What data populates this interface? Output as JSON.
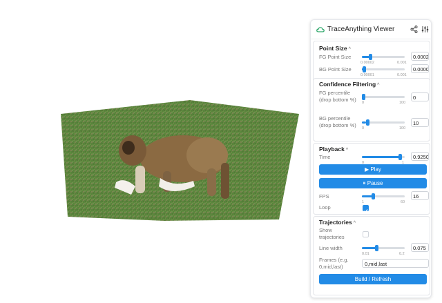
{
  "app": {
    "title": "TraceAnything Viewer"
  },
  "icons": {
    "logo": "cloud-icon",
    "share": "share-icon",
    "settings": "sliders-icon"
  },
  "colors": {
    "accent": "#228be6",
    "panel_border": "#e6e8ec"
  },
  "point_size": {
    "title": "Point Size",
    "fg": {
      "label": "FG Point Size",
      "min": "0.00002",
      "max": "0.001",
      "value": "0.0002",
      "fraction": 0.18
    },
    "bg": {
      "label": "BG Point Size",
      "min": "0.00001",
      "max": "0.001",
      "value": "0.0000",
      "fraction": 0.02
    }
  },
  "confidence": {
    "title": "Confidence Filtering",
    "fg": {
      "label": "FG percentile (drop bottom %)",
      "min": "0",
      "max": "100",
      "value": "0",
      "fraction": 0.0
    },
    "bg": {
      "label": "BG percentile (drop bottom %)",
      "min": "0",
      "max": "100",
      "value": "10",
      "fraction": 0.1
    }
  },
  "playback": {
    "title": "Playback",
    "time": {
      "label": "Time",
      "min": "0",
      "max": "1",
      "value": "0.9250",
      "fraction": 0.925
    },
    "play_label": "▶ Play",
    "pause_label": "⏸ Pause",
    "fps": {
      "label": "FPS",
      "min": "1",
      "max": "60",
      "value": "16",
      "fraction": 0.25
    },
    "loop": {
      "label": "Loop",
      "checked": true
    }
  },
  "trajectories": {
    "title": "Trajectories",
    "show": {
      "label": "Show trajectories",
      "checked": false
    },
    "line_width": {
      "label": "Line width",
      "min": "0.01",
      "max": "0.2",
      "value": "0.075",
      "fraction": 0.34
    },
    "frames": {
      "label": "Frames (e.g. 0,mid,last)",
      "value": "0,mid,last"
    },
    "build_label": "Build / Refresh"
  }
}
